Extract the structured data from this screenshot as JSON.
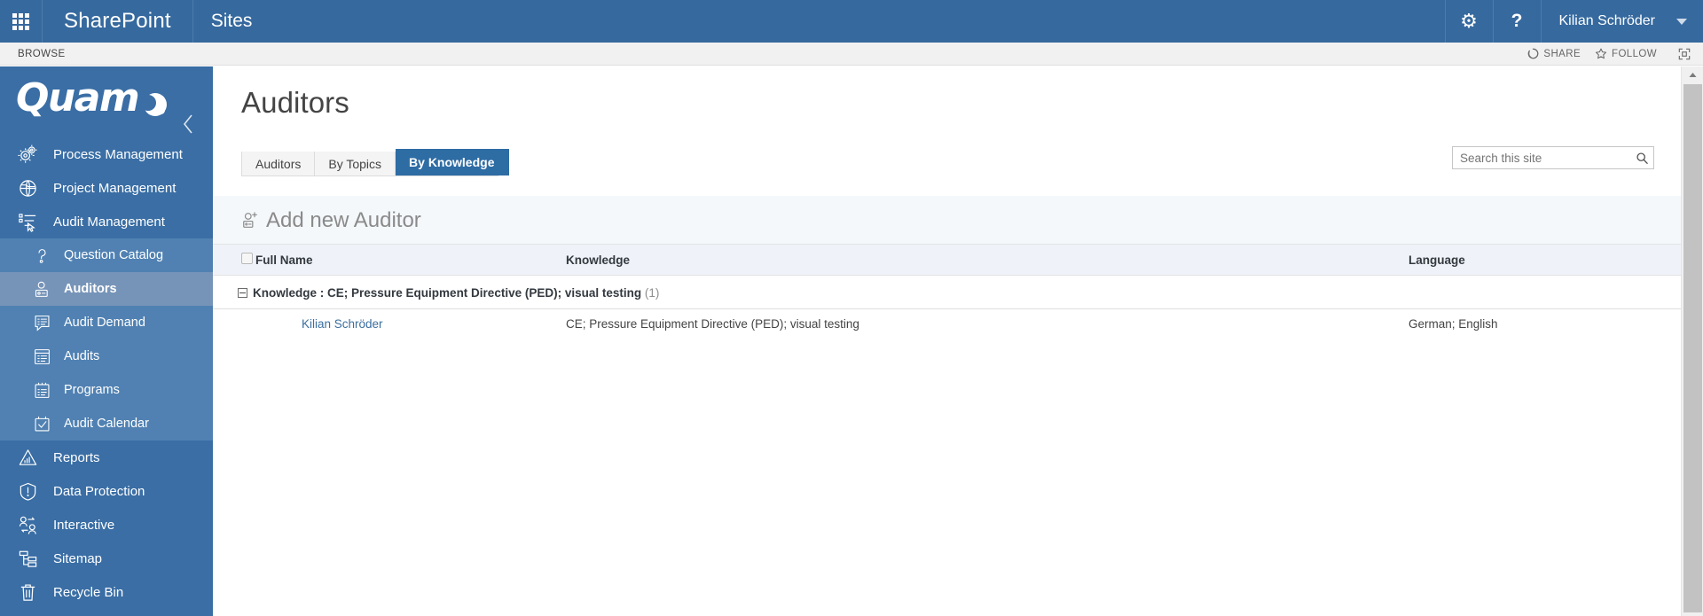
{
  "suitebar": {
    "app_launcher": "app-launcher",
    "brand": "SharePoint",
    "site": "Sites",
    "settings_icon": "gear-icon",
    "help_icon": "help-icon",
    "user_name": "Kilian Schröder"
  },
  "ribbon": {
    "browse_tab": "BROWSE",
    "share": "SHARE",
    "follow": "FOLLOW",
    "focus_icon": "focus-on-content-icon"
  },
  "sidebar": {
    "logo_text": "Quam",
    "collapse_icon": "chevron-left-icon",
    "items": [
      {
        "label": "Process Management",
        "icon": "gears-icon",
        "level": "top",
        "active": false
      },
      {
        "label": "Project Management",
        "icon": "globe-folder-icon",
        "level": "top",
        "active": false
      },
      {
        "label": "Audit Management",
        "icon": "list-cursor-icon",
        "level": "top",
        "active": false
      },
      {
        "label": "Question Catalog",
        "icon": "question-mark-icon",
        "level": "sub",
        "active": false
      },
      {
        "label": "Auditors",
        "icon": "person-badge-icon",
        "level": "sub",
        "active": true
      },
      {
        "label": "Audit Demand",
        "icon": "list-speech-icon",
        "level": "sub",
        "active": false
      },
      {
        "label": "Audits",
        "icon": "list-document-icon",
        "level": "sub",
        "active": false
      },
      {
        "label": "Programs",
        "icon": "clipboard-list-icon",
        "level": "sub",
        "active": false
      },
      {
        "label": "Audit Calendar",
        "icon": "calendar-check-icon",
        "level": "sub",
        "active": false
      },
      {
        "label": "Reports",
        "icon": "chart-bars-icon",
        "level": "top",
        "active": false
      },
      {
        "label": "Data Protection",
        "icon": "shield-alert-icon",
        "level": "top",
        "active": false
      },
      {
        "label": "Interactive",
        "icon": "two-people-exchange-icon",
        "level": "top",
        "active": false
      },
      {
        "label": "Sitemap",
        "icon": "sitemap-icon",
        "level": "top",
        "active": false
      },
      {
        "label": "Recycle Bin",
        "icon": "trash-icon",
        "level": "top",
        "active": false
      }
    ]
  },
  "main": {
    "page_title": "Auditors",
    "search": {
      "placeholder": "Search this site",
      "value": "",
      "icon": "search-icon"
    },
    "tabs": [
      {
        "label": "Auditors",
        "active": false
      },
      {
        "label": "By Topics",
        "active": false
      },
      {
        "label": "By Knowledge",
        "active": true
      }
    ],
    "add_new": {
      "label": "Add new Auditor",
      "icon": "add-person-icon"
    },
    "table": {
      "columns": [
        "Full Name",
        "Knowledge",
        "Language"
      ],
      "groups": [
        {
          "field_label": "Knowledge",
          "separator": " : ",
          "value": "CE; Pressure Equipment Directive (PED); visual testing",
          "count": "(1)",
          "expanded": true,
          "rows": [
            {
              "full_name": "Kilian Schröder",
              "knowledge": "CE; Pressure Equipment Directive (PED); visual testing",
              "language": "German; English"
            }
          ]
        }
      ]
    }
  },
  "colors": {
    "suite_bar": "#36699e",
    "sidebar": "#3a6ea5",
    "sidebar_sub": "#5081b2",
    "sidebar_active": "#7694b8",
    "tab_active": "#2e6ca4",
    "link": "#3b6e9e",
    "header_row": "#eff3f9"
  }
}
